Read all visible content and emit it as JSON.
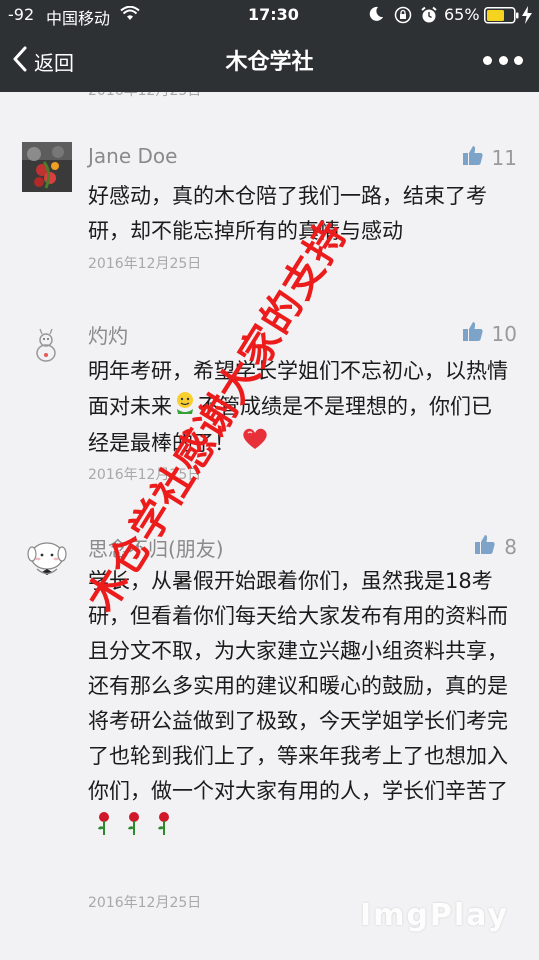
{
  "status_bar": {
    "signal": "-92",
    "carrier": "中国移动",
    "time": "17:30",
    "battery": "65%"
  },
  "nav": {
    "back_label": "返回",
    "title": "木仓学社"
  },
  "previous_date": "2016年12月25日",
  "comments": [
    {
      "name": "Jane Doe",
      "likes": "11",
      "text": "好感动，真的木仓陪了我们一路，结束了考研，却不能忘掉所有的真情与感动",
      "date": "2016年12月25日"
    },
    {
      "name": "灼灼",
      "likes": "10",
      "text_before_emoji": "明年考研，希望学长学姐们不忘初心，以热情面对未来",
      "text_after_emoji": "不管成绩是不是理想的，你们已经是最棒的了！",
      "date": "2016年12月25日"
    },
    {
      "name": "思念不归(朋友)",
      "likes": "8",
      "text": "学长，从暑假开始跟着你们，虽然我是18考研，但看着你们每天给大家发布有用的资料而且分文不取，为大家建立兴趣小组资料共享，还有那么多实用的建议和暖心的鼓励，真的是将考研公益做到了极致，今天学姐学长们考完了也轮到我们上了，等来年我考上了也想加入你们，做一个对大家有用的人，学长们辛苦了",
      "date": "2016年12月25日"
    }
  ],
  "watermark": "木仓学社感谢大家的支持",
  "corner_watermark": "ImgPlay",
  "icons": {
    "like": "thumbs-up-icon",
    "back": "chevron-left-icon",
    "more": "more-dots-icon",
    "wifi": "wifi-icon",
    "moon": "moon-icon",
    "lock": "rotation-lock-icon",
    "alarm": "alarm-icon",
    "battery": "battery-icon",
    "charging": "charging-icon"
  },
  "colors": {
    "nav_bg": "#2e3134",
    "like_blue": "#7da4c8",
    "watermark_red": "#ec1c1c",
    "battery_yellow": "#f6d31e"
  }
}
